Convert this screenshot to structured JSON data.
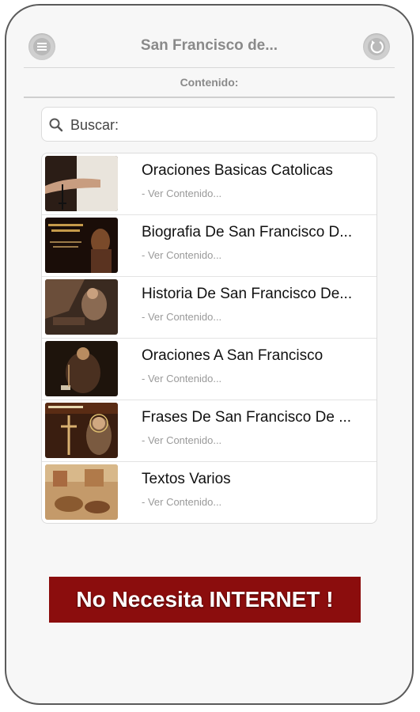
{
  "header": {
    "title": "San Francisco de...",
    "menu_icon": "menu-icon",
    "back_icon": "back-icon"
  },
  "subheader": {
    "label": "Contenido:"
  },
  "search": {
    "placeholder": "Buscar:",
    "value": "",
    "icon": "search-icon"
  },
  "list": {
    "items": [
      {
        "title": "Oraciones Basicas Catolicas",
        "subtitle": "- Ver Contenido..."
      },
      {
        "title": "Biografia De San Francisco D...",
        "subtitle": "- Ver Contenido..."
      },
      {
        "title": "Historia De San Francisco De...",
        "subtitle": "- Ver Contenido..."
      },
      {
        "title": "Oraciones A San Francisco",
        "subtitle": "- Ver Contenido..."
      },
      {
        "title": "Frases De San Francisco De ...",
        "subtitle": "- Ver Contenido..."
      },
      {
        "title": "Textos Varios",
        "subtitle": "- Ver Contenido..."
      }
    ]
  },
  "banner": {
    "text": "No Necesita INTERNET !"
  },
  "colors": {
    "banner_bg": "#8b0d0d",
    "header_text": "#8a8a8a",
    "subtitle_text": "#9a9a9a"
  }
}
